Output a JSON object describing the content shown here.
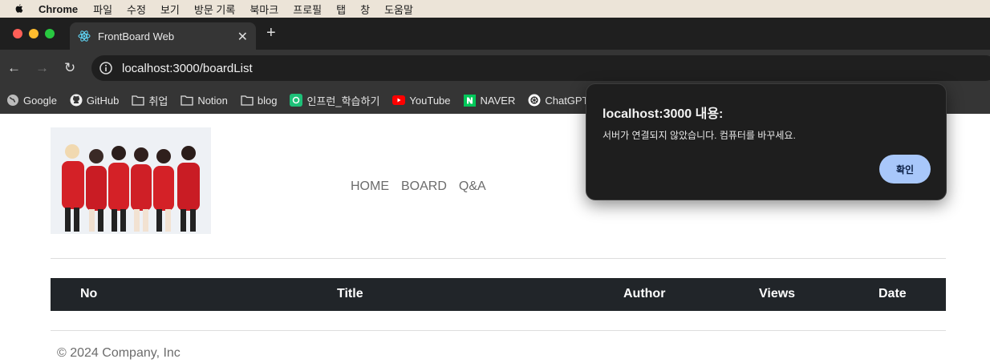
{
  "menubar": {
    "app": "Chrome",
    "items": [
      "파일",
      "수정",
      "보기",
      "방문 기록",
      "북마크",
      "프로필",
      "탭",
      "창",
      "도움말"
    ]
  },
  "browser": {
    "tab_title": "FrontBoard Web",
    "url": "localhost:3000/boardList",
    "new_tab_icon": "plus-icon",
    "colors": {
      "close": "#ff5f57",
      "minimize": "#febc2e",
      "zoom": "#28c840"
    }
  },
  "bookmarks": [
    {
      "label": "Google",
      "icon": "globe-icon"
    },
    {
      "label": "GitHub",
      "icon": "github-icon"
    },
    {
      "label": "취업",
      "icon": "folder-icon"
    },
    {
      "label": "Notion",
      "icon": "folder-icon"
    },
    {
      "label": "blog",
      "icon": "folder-icon"
    },
    {
      "label": "인프런_학습하기",
      "icon": "inflearn-icon"
    },
    {
      "label": "YouTube",
      "icon": "youtube-icon"
    },
    {
      "label": "NAVER",
      "icon": "naver-icon"
    },
    {
      "label": "ChatGPT",
      "icon": "chatgpt-icon"
    }
  ],
  "page": {
    "nav": [
      "HOME",
      "BOARD",
      "Q&A"
    ],
    "table_headers": [
      "No",
      "Title",
      "Author",
      "Views",
      "Date"
    ],
    "footer": "© 2024 Company, Inc"
  },
  "dialog": {
    "title": "localhost:3000 내용:",
    "message": "서버가 연결되지 않았습니다. 컴퓨터를 바꾸세요.",
    "ok_label": "확인",
    "ok_color": "#a8c7fa"
  }
}
